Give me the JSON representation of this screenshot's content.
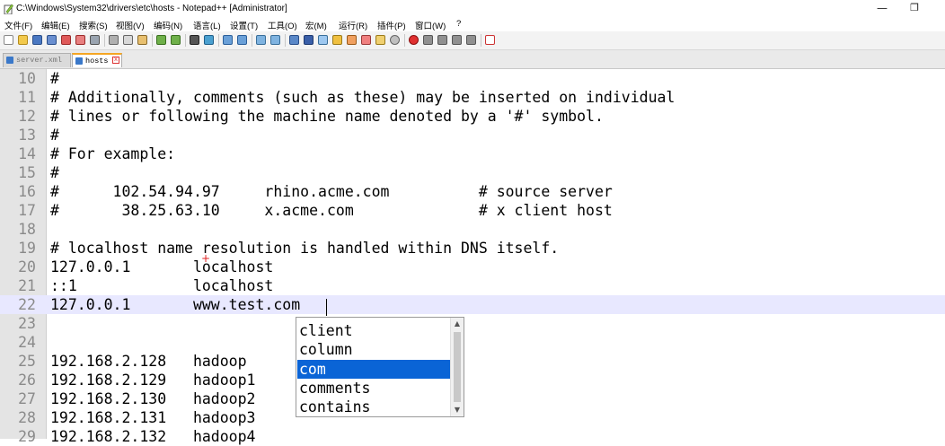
{
  "window": {
    "title": "C:\\Windows\\System32\\drivers\\etc\\hosts - Notepad++ [Administrator]",
    "minimize_glyph": "—",
    "restore_glyph": "❐"
  },
  "menu": [
    "文件(F)",
    "编辑(E)",
    "搜索(S)",
    "视图(V)",
    "编码(N)",
    "语言(L)",
    "设置(T)",
    "工具(O)",
    "宏(M)",
    "运行(R)",
    "插件(P)",
    "窗口(W)",
    "?"
  ],
  "tabs": [
    {
      "label": "server.xml",
      "active": false
    },
    {
      "label": "hosts",
      "active": true
    }
  ],
  "tab_close_glyph": "x",
  "editor": {
    "current_line": "22",
    "lines": [
      {
        "num": "10",
        "text": "#"
      },
      {
        "num": "11",
        "text": "# Additionally, comments (such as these) may be inserted on individual"
      },
      {
        "num": "12",
        "text": "# lines or following the machine name denoted by a '#' symbol."
      },
      {
        "num": "13",
        "text": "#"
      },
      {
        "num": "14",
        "text": "# For example:"
      },
      {
        "num": "15",
        "text": "#"
      },
      {
        "num": "16",
        "text": "#      102.54.94.97     rhino.acme.com          # source server"
      },
      {
        "num": "17",
        "text": "#       38.25.63.10     x.acme.com              # x client host"
      },
      {
        "num": "18",
        "text": ""
      },
      {
        "num": "19",
        "text": "# localhost name resolution is handled within DNS itself."
      },
      {
        "num": "20",
        "text": "127.0.0.1       localhost"
      },
      {
        "num": "21",
        "text": "::1             localhost"
      },
      {
        "num": "22",
        "text": "127.0.0.1       www.test.com"
      },
      {
        "num": "23",
        "text": ""
      },
      {
        "num": "24",
        "text": ""
      },
      {
        "num": "25",
        "text": "192.168.2.128   hadoop"
      },
      {
        "num": "26",
        "text": "192.168.2.129   hadoop1"
      },
      {
        "num": "27",
        "text": "192.168.2.130   hadoop2"
      },
      {
        "num": "28",
        "text": "192.168.2.131   hadoop3"
      },
      {
        "num": "29",
        "text": "192.168.2.132   hadoop4"
      }
    ]
  },
  "autocomplete": {
    "items": [
      "client",
      "column",
      "com",
      "comments",
      "contains"
    ],
    "selected": "com",
    "scroll_up_glyph": "▲",
    "scroll_down_glyph": "▼"
  },
  "cursor_glyph": "+",
  "icons": {
    "app": "notepad-plus-plus-icon",
    "toolbar": [
      "new-file-icon",
      "open-file-icon",
      "save-icon",
      "save-all-icon",
      "close-icon",
      "close-all-icon",
      "print-icon",
      "cut-icon",
      "copy-icon",
      "paste-icon",
      "undo-icon",
      "redo-icon",
      "find-icon",
      "replace-icon",
      "zoom-in-icon",
      "zoom-out-icon",
      "sync-vertical-icon",
      "sync-horizontal-icon",
      "word-wrap-icon",
      "show-all-chars-icon",
      "indent-guide-icon",
      "user-language-icon",
      "document-map-icon",
      "function-list-icon",
      "folder-workspace-icon",
      "monitoring-icon",
      "record-macro-icon",
      "stop-record-icon",
      "play-macro-icon",
      "run-macro-multiple-icon",
      "save-macro-icon",
      "spell-check-icon"
    ]
  },
  "colors": {
    "gutter_bg": "#e4e4e4",
    "line_number": "#8a8a8a",
    "current_line_bg": "#e8e8ff",
    "selection": "#0a64d6",
    "tab_accent": "#f5a623"
  }
}
